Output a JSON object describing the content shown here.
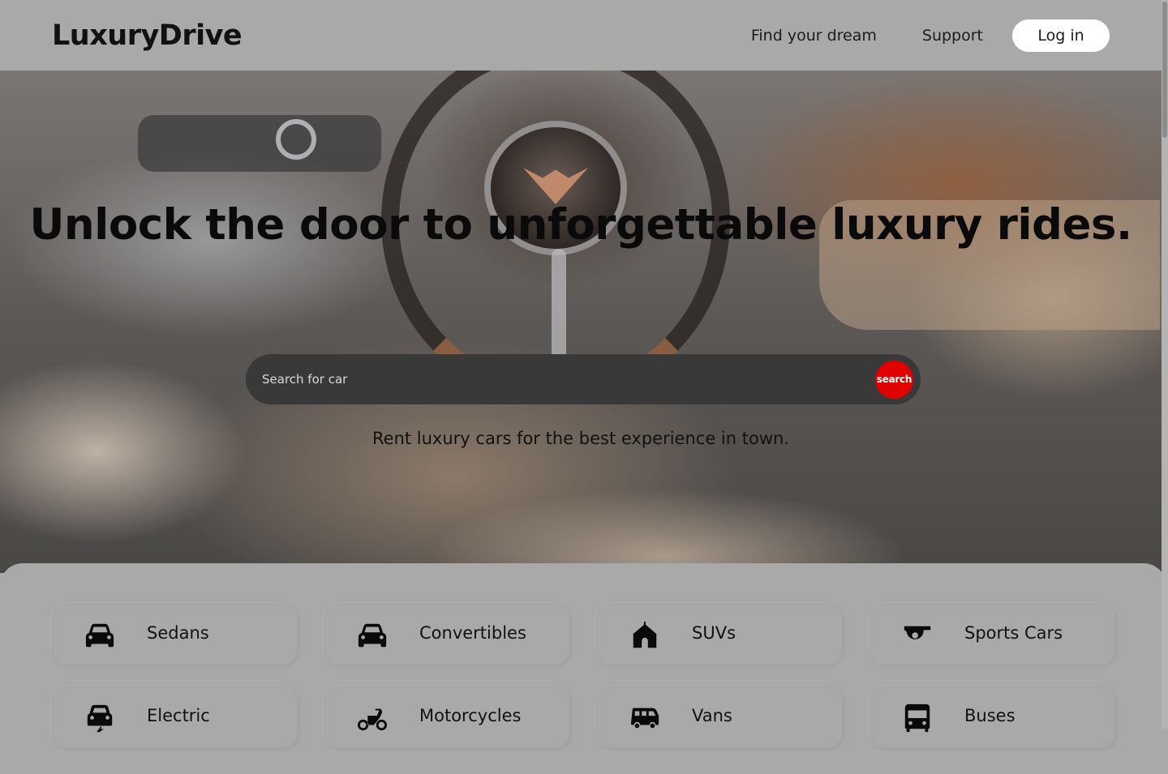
{
  "header": {
    "logo": "LuxuryDrive",
    "nav": [
      {
        "label": "Find your dream"
      },
      {
        "label": "Support"
      }
    ],
    "login_label": "Log in"
  },
  "hero": {
    "title": "Unlock the door to unforgettable luxury rides.",
    "search": {
      "placeholder": "Search for car",
      "button_label": "search"
    },
    "tagline": "Rent luxury cars for the best experience in town."
  },
  "categories": [
    {
      "label": "Sedans",
      "icon": "car-icon"
    },
    {
      "label": "Convertibles",
      "icon": "car-icon"
    },
    {
      "label": "SUVs",
      "icon": "house-icon"
    },
    {
      "label": "Sports Cars",
      "icon": "whistle-icon"
    },
    {
      "label": "Electric",
      "icon": "electric-car-icon"
    },
    {
      "label": "Motorcycles",
      "icon": "motorcycle-icon"
    },
    {
      "label": "Vans",
      "icon": "van-icon"
    },
    {
      "label": "Buses",
      "icon": "bus-icon"
    }
  ],
  "colors": {
    "background": "#a9a9a9",
    "search_bar": "#3a3939",
    "search_button": "#e00000",
    "login_button": "#ffffff"
  }
}
